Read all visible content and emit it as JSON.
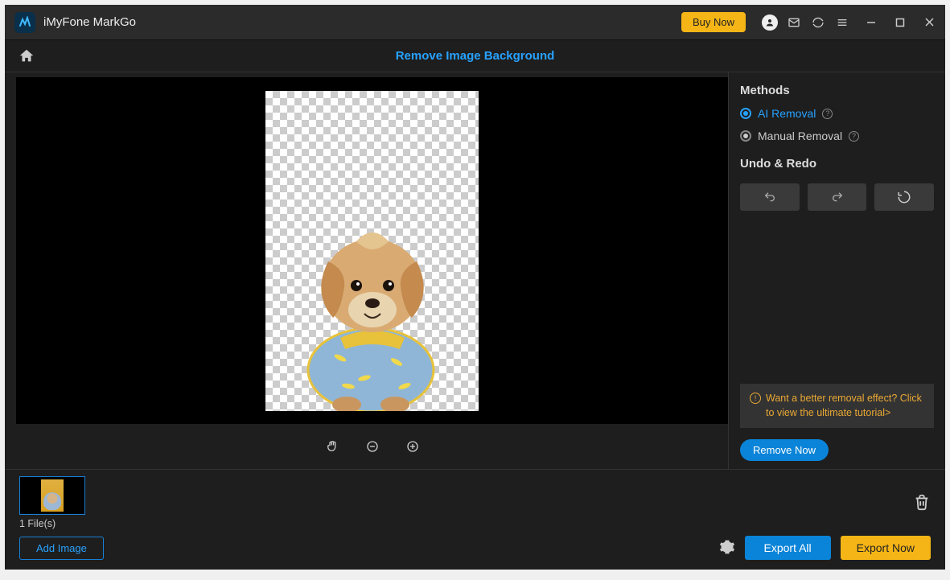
{
  "titlebar": {
    "app_name": "iMyFone MarkGo",
    "buy_now": "Buy Now"
  },
  "header": {
    "mode_title": "Remove Image Background"
  },
  "panel": {
    "methods_heading": "Methods",
    "ai_removal_label": "AI Removal",
    "manual_removal_label": "Manual Removal",
    "undo_heading": "Undo & Redo",
    "tip_text": "Want a better removal effect? Click to view the ultimate tutorial>",
    "remove_now": "Remove Now"
  },
  "bottom": {
    "file_count": "1 File(s)",
    "add_image": "Add Image",
    "export_all": "Export All",
    "export_now": "Export Now"
  }
}
